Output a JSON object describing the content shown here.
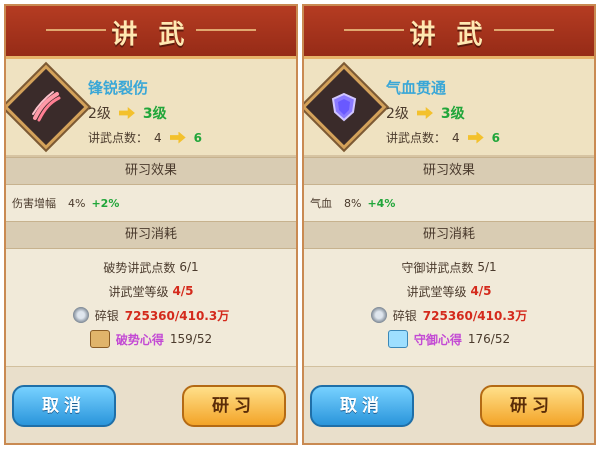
{
  "panels": [
    {
      "title": "讲 武",
      "skill_name": "锋锐裂伤",
      "level_from": "2级",
      "level_to": "3级",
      "points_label": "讲武点数：",
      "points_from": "4",
      "points_to": "6",
      "effect_header": "研习效果",
      "effect_label": "伤害增幅",
      "effect_value": "4%",
      "effect_delta": "+2%",
      "cost_header": "研习消耗",
      "cost_points_label": "破势讲武点数",
      "cost_points_value": "6/1",
      "cost_hall_label": "讲武堂等级",
      "cost_hall_value": "4/5",
      "cost_silver_label": "碎银",
      "cost_silver_value": "725360/410.3万",
      "cost_item_label": "破势心得",
      "cost_item_value": "159/52",
      "cancel": "取消",
      "study": "研习",
      "icon": "claw-slash-icon",
      "icon_color": "#ff9aa8"
    },
    {
      "title": "讲 武",
      "skill_name": "气血贯通",
      "level_from": "2级",
      "level_to": "3级",
      "points_label": "讲武点数：",
      "points_from": "4",
      "points_to": "6",
      "effect_header": "研习效果",
      "effect_label": "气血",
      "effect_value": "8%",
      "effect_delta": "+4%",
      "cost_header": "研习消耗",
      "cost_points_label": "守御讲武点数",
      "cost_points_value": "5/1",
      "cost_hall_label": "讲武堂等级",
      "cost_hall_value": "4/5",
      "cost_silver_label": "碎银",
      "cost_silver_value": "725360/410.3万",
      "cost_item_label": "守御心得",
      "cost_item_value": "176/52",
      "cancel": "取消",
      "study": "研习",
      "icon": "shield-aura-icon",
      "icon_color": "#b9a6ff"
    }
  ]
}
